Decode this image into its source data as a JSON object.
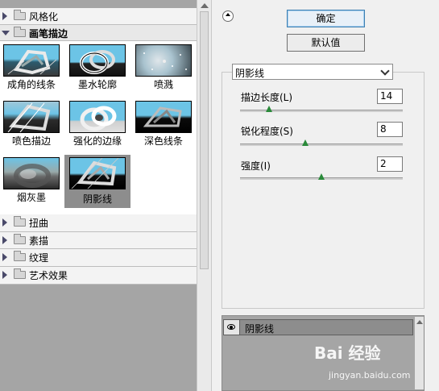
{
  "filter_gallery": {
    "categories_top": [
      {
        "label": "风格化",
        "expanded": false
      },
      {
        "label": "画笔描边",
        "expanded": true
      }
    ],
    "thumbnails": [
      {
        "label": "成角的线条"
      },
      {
        "label": "墨水轮廓"
      },
      {
        "label": "喷溅"
      },
      {
        "label": "喷色描边"
      },
      {
        "label": "强化的边缘"
      },
      {
        "label": "深色线条"
      },
      {
        "label": "烟灰墨"
      },
      {
        "label": "阴影线",
        "selected": true
      }
    ],
    "categories_bottom": [
      {
        "label": "扭曲"
      },
      {
        "label": "素描"
      },
      {
        "label": "纹理"
      },
      {
        "label": "艺术效果"
      }
    ]
  },
  "buttons": {
    "ok": "确定",
    "default": "默认值"
  },
  "filter_select": {
    "value": "阴影线"
  },
  "params": [
    {
      "label": "描边长度(L)",
      "value": "14",
      "level": 0.18
    },
    {
      "label": "锐化程度(S)",
      "value": "8",
      "level": 0.4
    },
    {
      "label": "强度(I)",
      "value": "2",
      "level": 0.5
    }
  ],
  "layers": {
    "items": [
      {
        "label": "阴影线"
      }
    ]
  },
  "watermark": {
    "text": "Bai 经验",
    "url": "jingyan.baidu.com"
  },
  "colors": {
    "selected_thumb_bg": "#8d8d8d",
    "slider_knob": "#2a8a3a",
    "ok_button_border": "#3c7fb1"
  }
}
